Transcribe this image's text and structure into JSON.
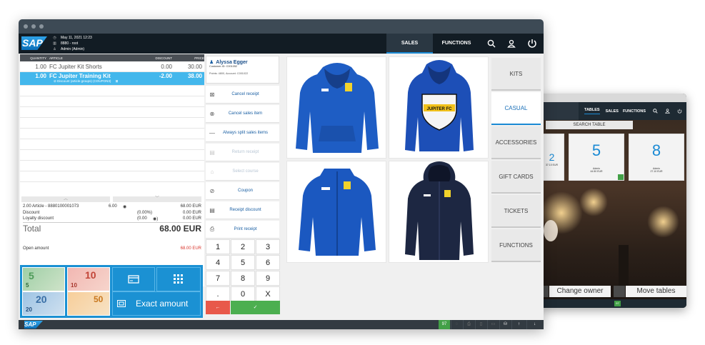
{
  "main_window": {
    "header": {
      "logo": "SAP",
      "datetime": "May 11, 2021 12:23",
      "store": "8880 - root",
      "user": "Admin (Admin)",
      "tabs": [
        "SALES",
        "FUNCTIONS"
      ],
      "active_tab": "SALES",
      "icons": [
        "search-icon",
        "user-icon",
        "power-icon"
      ]
    },
    "receipt": {
      "columns": {
        "quantity": "QUANTITY",
        "article": "ARTICLE",
        "discount": "DISCOUNT",
        "price": "PRICE"
      },
      "items": [
        {
          "quantity": "1.00",
          "article": "FC Jupiter Kit Shorts",
          "discount": "0.00",
          "price": "30.00",
          "note": ""
        },
        {
          "quantity": "1.00",
          "article": "FC Jupiter Training Kit",
          "discount": "-2.00",
          "price": "38.00",
          "note": "Discount (article groups) (COUPON3)"
        }
      ],
      "summary": {
        "article_line": "2.00 Article - 8880100001073",
        "article_amount": "6.00",
        "article_total": "68.00 EUR",
        "discount_label": "Discount",
        "discount_pct": "(0.00%)",
        "discount_value": "0.00 EUR",
        "loyalty_label": "Loyalty discount",
        "loyalty_pct": "(0.00",
        "loyalty_value": "0.00 EUR",
        "total_label": "Total",
        "total_value": "68.00 EUR",
        "open_label": "Open amount",
        "open_value": "68.00 EUR"
      }
    },
    "payment": {
      "bills": [
        "5",
        "10",
        "20",
        "50"
      ],
      "exact_amount": "Exact amount"
    },
    "customer": {
      "name": "Alyssa Egger",
      "id_line": "Customer-ID: C001052",
      "points_line": "Points: 4800, Account: C001022"
    },
    "actions": [
      {
        "label": "Cancel receipt",
        "icon": "cancel-receipt-icon",
        "enabled": true
      },
      {
        "label": "Cancel sales item",
        "icon": "cancel-item-icon",
        "enabled": true
      },
      {
        "label": "Always split sales items",
        "icon": "split-icon",
        "enabled": true
      },
      {
        "label": "Return receipt",
        "icon": "return-receipt-icon",
        "enabled": false
      },
      {
        "label": "Select course",
        "icon": "course-icon",
        "enabled": false
      },
      {
        "label": "Coupon",
        "icon": "coupon-icon",
        "enabled": true
      },
      {
        "label": "Receipt discount",
        "icon": "receipt-discount-icon",
        "enabled": true
      },
      {
        "label": "Print receipt",
        "icon": "print-icon",
        "enabled": true
      }
    ],
    "keypad": {
      "keys": [
        "1",
        "2",
        "3",
        "4",
        "5",
        "6",
        "7",
        "8",
        "9",
        ".",
        "0",
        "X"
      ],
      "back": "←",
      "ok": "✓"
    },
    "products": [
      {
        "name": "blue hoodie",
        "type": "hoodie",
        "color": "#1e5dc4",
        "crest_text": ""
      },
      {
        "name": "blue hoodie with crest",
        "type": "hoodie-crest",
        "color": "#1d4fb7",
        "crest_text": "JUPITER FC"
      },
      {
        "name": "blue track jacket",
        "type": "jacket",
        "color": "#1b58c0",
        "crest_text": ""
      },
      {
        "name": "navy rain jacket",
        "type": "parka",
        "color": "#1d2742",
        "crest_text": ""
      }
    ],
    "categories": [
      "KITS",
      "CASUAL",
      "ACCESSORIES",
      "GIFT CARDS",
      "TICKETS",
      "FUNCTIONS"
    ],
    "active_category": "CASUAL",
    "footer": {
      "logo": "SAP",
      "counter": "97"
    }
  },
  "second_window": {
    "tabs": [
      "TABLES",
      "SALES",
      "FUNCTIONS"
    ],
    "search_label": "SEARCH TABLE",
    "tables": [
      {
        "number": "2",
        "sub": "37.10 EUR"
      },
      {
        "number": "5",
        "sub": "Admin",
        "amount": "44.50 EUR"
      },
      {
        "number": "8",
        "sub": "Admin",
        "amount": "27.10 EUR"
      }
    ],
    "change_owner": "Change owner",
    "move_tables": "Move tables",
    "counter": "97"
  }
}
